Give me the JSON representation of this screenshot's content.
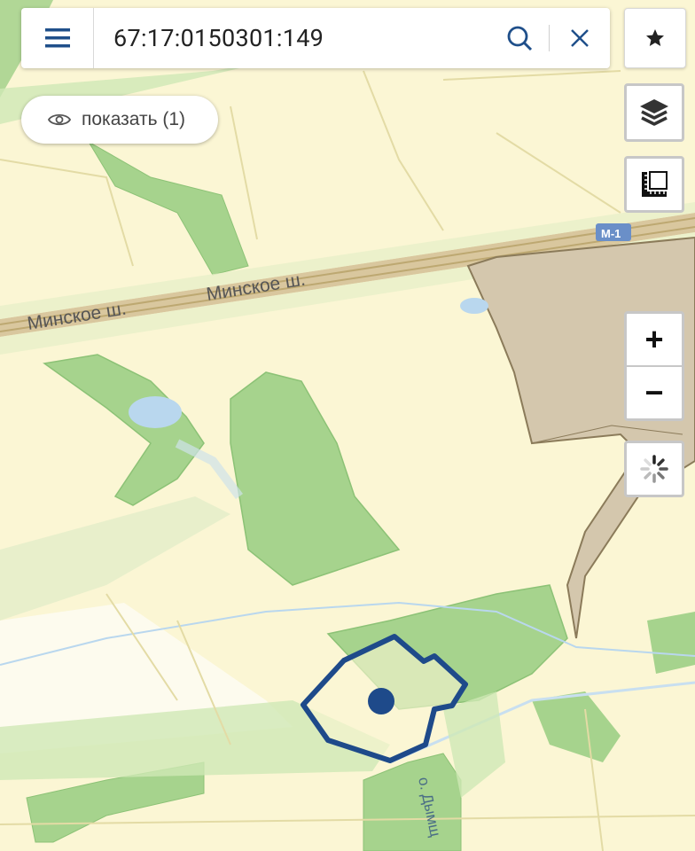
{
  "search": {
    "value": "67:17:0150301:149"
  },
  "show_button": {
    "label": "показать (1)"
  },
  "zoom": {
    "in_label": "+",
    "out_label": "−"
  },
  "map": {
    "road_labels": [
      "Минское ш.",
      "Минское ш."
    ],
    "highway_badge": "М-1",
    "street_label": "о. Дымщ"
  },
  "icons": {
    "menu": "menu-icon",
    "search": "search-icon",
    "clear": "close-icon",
    "favorite": "star-icon",
    "layers": "layers-icon",
    "measure": "ruler-icon",
    "show": "eye-icon",
    "loading": "spinner-icon"
  },
  "colors": {
    "accent": "#1f4f8a",
    "parcel_outline": "#1e4a8a",
    "forest": "#a6d38d",
    "field": "#fbf6d4",
    "industrial": "#d4c7ad",
    "highway": "#d8c8a0"
  }
}
